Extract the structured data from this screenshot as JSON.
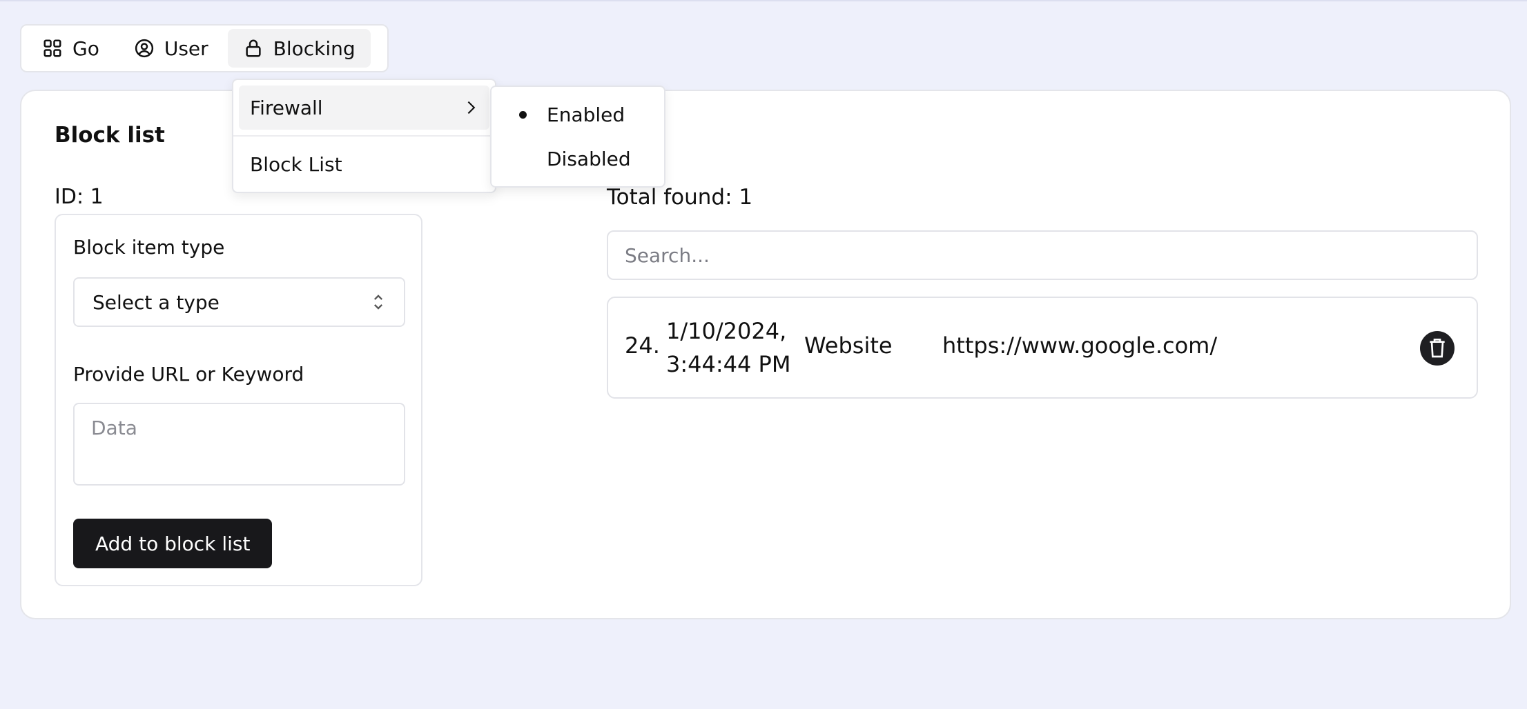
{
  "nav": {
    "items": [
      {
        "label": "Go",
        "icon": "grid-icon"
      },
      {
        "label": "User",
        "icon": "user-circle-icon"
      },
      {
        "label": "Blocking",
        "icon": "lock-icon"
      }
    ]
  },
  "dropdown": {
    "items": [
      {
        "label": "Firewall",
        "has_submenu": true
      },
      {
        "label": "Block List",
        "has_submenu": false
      }
    ]
  },
  "submenu": {
    "items": [
      {
        "label": "Enabled",
        "selected": true
      },
      {
        "label": "Disabled",
        "selected": false
      }
    ]
  },
  "card": {
    "title": "Block list",
    "id_label": "ID: 1",
    "form": {
      "type_label": "Block item type",
      "type_select_value": "Select a type",
      "data_label": "Provide URL or Keyword",
      "data_placeholder": "Data",
      "add_button": "Add to block list"
    },
    "results": {
      "total_found": "Total found: 1",
      "search_placeholder": "Search...",
      "rows": [
        {
          "index": "24.",
          "date": "1/10/2024,",
          "time": "3:44:44 PM",
          "type": "Website",
          "url": "https://www.google.com/"
        }
      ]
    }
  },
  "colors": {
    "background": "#eef0fb",
    "primary_button": "#18181b",
    "border": "#e4e5ea"
  }
}
